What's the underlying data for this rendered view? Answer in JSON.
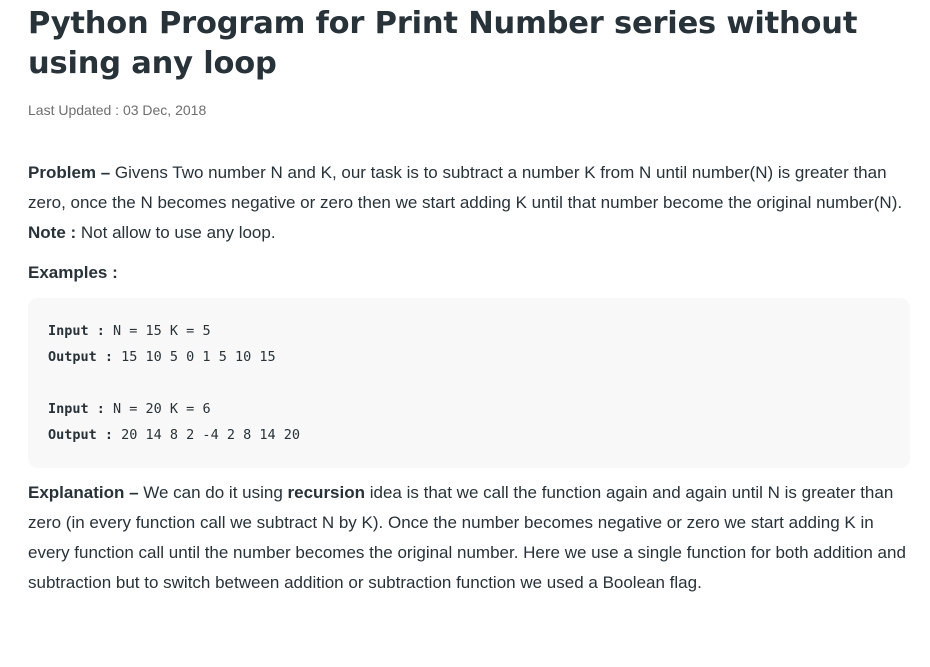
{
  "article": {
    "title": "Python Program for Print Number series without using any loop",
    "last_updated": "Last Updated : 03 Dec, 2018"
  },
  "problem": {
    "label": "Problem – ",
    "text": "Givens Two number N and K, our task is to subtract a number K from N until number(N) is greater than zero, once the N becomes negative or zero then we start adding K until that number become the original number(N)."
  },
  "note": {
    "label": "Note : ",
    "text": "Not allow to use any loop."
  },
  "examples_heading": "Examples :",
  "examples": [
    {
      "input_label": "Input :",
      "input_value": " N = 15 K = 5",
      "output_label": "Output :",
      "output_value": " 15 10 5 0 1 5 10 15"
    },
    {
      "input_label": "Input :",
      "input_value": " N = 20 K = 6",
      "output_label": "Output :",
      "output_value": " 20 14 8 2 -4 2 8 14 20"
    }
  ],
  "explanation": {
    "label": "Explanation – ",
    "text_before": "We can do it using ",
    "highlight": "recursion",
    "text_after": " idea is that we call the function again and again until N is greater than zero (in every function call we subtract N by K). Once the number becomes negative or zero we start adding K in every function call until the number becomes the original number. Here we use a single function for both addition and subtraction but to switch between addition or subtraction function we used a Boolean flag."
  }
}
